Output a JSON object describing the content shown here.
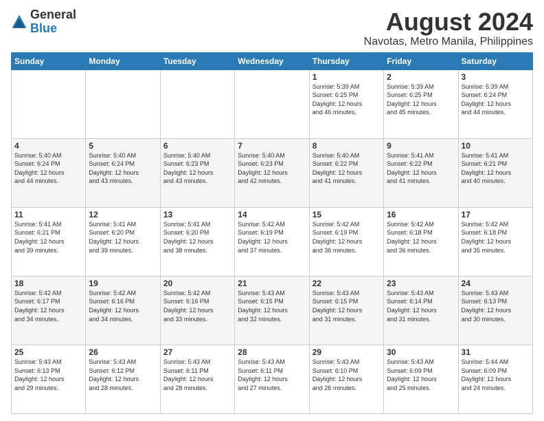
{
  "logo": {
    "text_general": "General",
    "text_blue": "Blue"
  },
  "header": {
    "month_year": "August 2024",
    "location": "Navotas, Metro Manila, Philippines"
  },
  "days_of_week": [
    "Sunday",
    "Monday",
    "Tuesday",
    "Wednesday",
    "Thursday",
    "Friday",
    "Saturday"
  ],
  "weeks": [
    [
      {
        "day": "",
        "info": ""
      },
      {
        "day": "",
        "info": ""
      },
      {
        "day": "",
        "info": ""
      },
      {
        "day": "",
        "info": ""
      },
      {
        "day": "1",
        "info": "Sunrise: 5:39 AM\nSunset: 6:25 PM\nDaylight: 12 hours\nand 46 minutes."
      },
      {
        "day": "2",
        "info": "Sunrise: 5:39 AM\nSunset: 6:25 PM\nDaylight: 12 hours\nand 45 minutes."
      },
      {
        "day": "3",
        "info": "Sunrise: 5:39 AM\nSunset: 6:24 PM\nDaylight: 12 hours\nand 44 minutes."
      }
    ],
    [
      {
        "day": "4",
        "info": "Sunrise: 5:40 AM\nSunset: 6:24 PM\nDaylight: 12 hours\nand 44 minutes."
      },
      {
        "day": "5",
        "info": "Sunrise: 5:40 AM\nSunset: 6:24 PM\nDaylight: 12 hours\nand 43 minutes."
      },
      {
        "day": "6",
        "info": "Sunrise: 5:40 AM\nSunset: 6:23 PM\nDaylight: 12 hours\nand 43 minutes."
      },
      {
        "day": "7",
        "info": "Sunrise: 5:40 AM\nSunset: 6:23 PM\nDaylight: 12 hours\nand 42 minutes."
      },
      {
        "day": "8",
        "info": "Sunrise: 5:40 AM\nSunset: 6:22 PM\nDaylight: 12 hours\nand 41 minutes."
      },
      {
        "day": "9",
        "info": "Sunrise: 5:41 AM\nSunset: 6:22 PM\nDaylight: 12 hours\nand 41 minutes."
      },
      {
        "day": "10",
        "info": "Sunrise: 5:41 AM\nSunset: 6:21 PM\nDaylight: 12 hours\nand 40 minutes."
      }
    ],
    [
      {
        "day": "11",
        "info": "Sunrise: 5:41 AM\nSunset: 6:21 PM\nDaylight: 12 hours\nand 39 minutes."
      },
      {
        "day": "12",
        "info": "Sunrise: 5:41 AM\nSunset: 6:20 PM\nDaylight: 12 hours\nand 39 minutes."
      },
      {
        "day": "13",
        "info": "Sunrise: 5:41 AM\nSunset: 6:20 PM\nDaylight: 12 hours\nand 38 minutes."
      },
      {
        "day": "14",
        "info": "Sunrise: 5:42 AM\nSunset: 6:19 PM\nDaylight: 12 hours\nand 37 minutes."
      },
      {
        "day": "15",
        "info": "Sunrise: 5:42 AM\nSunset: 6:19 PM\nDaylight: 12 hours\nand 36 minutes."
      },
      {
        "day": "16",
        "info": "Sunrise: 5:42 AM\nSunset: 6:18 PM\nDaylight: 12 hours\nand 36 minutes."
      },
      {
        "day": "17",
        "info": "Sunrise: 5:42 AM\nSunset: 6:18 PM\nDaylight: 12 hours\nand 35 minutes."
      }
    ],
    [
      {
        "day": "18",
        "info": "Sunrise: 5:42 AM\nSunset: 6:17 PM\nDaylight: 12 hours\nand 34 minutes."
      },
      {
        "day": "19",
        "info": "Sunrise: 5:42 AM\nSunset: 6:16 PM\nDaylight: 12 hours\nand 34 minutes."
      },
      {
        "day": "20",
        "info": "Sunrise: 5:42 AM\nSunset: 6:16 PM\nDaylight: 12 hours\nand 33 minutes."
      },
      {
        "day": "21",
        "info": "Sunrise: 5:43 AM\nSunset: 6:15 PM\nDaylight: 12 hours\nand 32 minutes."
      },
      {
        "day": "22",
        "info": "Sunrise: 5:43 AM\nSunset: 6:15 PM\nDaylight: 12 hours\nand 31 minutes."
      },
      {
        "day": "23",
        "info": "Sunrise: 5:43 AM\nSunset: 6:14 PM\nDaylight: 12 hours\nand 31 minutes."
      },
      {
        "day": "24",
        "info": "Sunrise: 5:43 AM\nSunset: 6:13 PM\nDaylight: 12 hours\nand 30 minutes."
      }
    ],
    [
      {
        "day": "25",
        "info": "Sunrise: 5:43 AM\nSunset: 6:13 PM\nDaylight: 12 hours\nand 29 minutes."
      },
      {
        "day": "26",
        "info": "Sunrise: 5:43 AM\nSunset: 6:12 PM\nDaylight: 12 hours\nand 28 minutes."
      },
      {
        "day": "27",
        "info": "Sunrise: 5:43 AM\nSunset: 6:11 PM\nDaylight: 12 hours\nand 28 minutes."
      },
      {
        "day": "28",
        "info": "Sunrise: 5:43 AM\nSunset: 6:11 PM\nDaylight: 12 hours\nand 27 minutes."
      },
      {
        "day": "29",
        "info": "Sunrise: 5:43 AM\nSunset: 6:10 PM\nDaylight: 12 hours\nand 26 minutes."
      },
      {
        "day": "30",
        "info": "Sunrise: 5:43 AM\nSunset: 6:09 PM\nDaylight: 12 hours\nand 25 minutes."
      },
      {
        "day": "31",
        "info": "Sunrise: 5:44 AM\nSunset: 6:09 PM\nDaylight: 12 hours\nand 24 minutes."
      }
    ]
  ]
}
